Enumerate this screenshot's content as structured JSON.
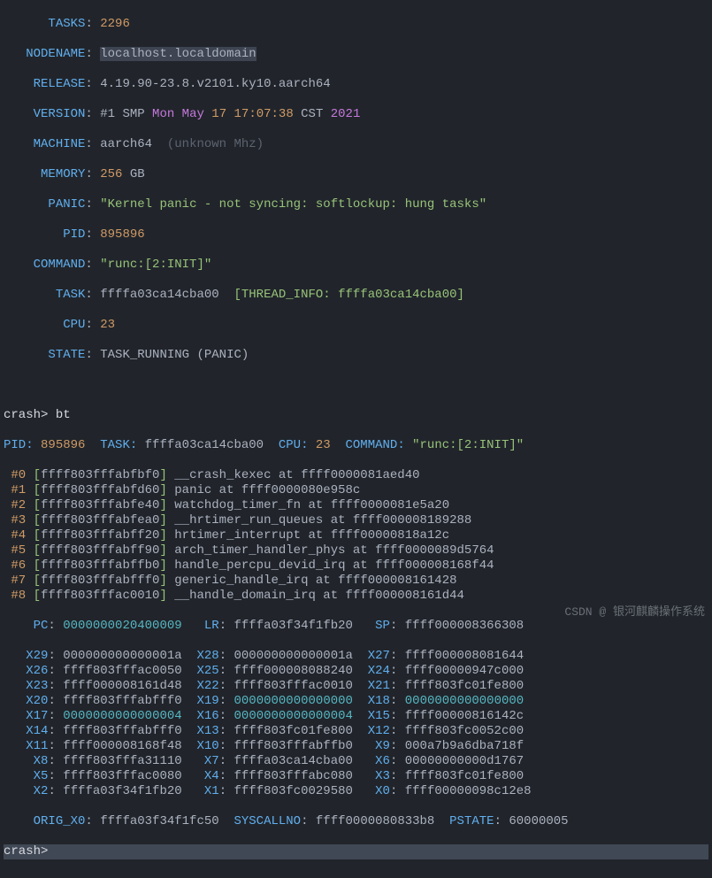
{
  "header": {
    "tasks_label": "TASKS",
    "tasks_value": "2296",
    "nodename_label": "NODENAME",
    "nodename_value": "localhost.localdomain",
    "release_label": "RELEASE",
    "release_value": "4.19.90-23.8.v2101.ky10.aarch64",
    "version_label": "VERSION",
    "version_prefix": "#1 SMP ",
    "version_weekday": "Mon",
    "version_month": "May",
    "version_day": "17",
    "version_time": "17:07:38",
    "version_tz": "CST ",
    "version_year": "2021",
    "machine_label": "MACHINE",
    "machine_value": "aarch64  ",
    "machine_paren": "(",
    "machine_unknown": "unknown",
    "machine_mhz": " Mhz)",
    "memory_label": "MEMORY",
    "memory_value": "256",
    "memory_unit": " GB",
    "panic_label": "PANIC",
    "panic_value": "\"Kernel panic - not syncing: softlockup: hung tasks\"",
    "pid_label": "PID",
    "pid_value": "895896",
    "command_label": "COMMAND",
    "command_value": "\"runc:[2:INIT]\"",
    "task_label": "TASK",
    "task_value": "ffffa03ca14cba00  ",
    "task_thread": "[THREAD_INFO: ffffa03ca14cba00]",
    "cpu_label": "CPU",
    "cpu_value": "23",
    "state_label": "STATE",
    "state_value": "TASK_RUNNING (PANIC)"
  },
  "cmd1": {
    "prompt": "crash> ",
    "text": "bt"
  },
  "bthdr": {
    "pid_l": "PID: ",
    "pid_v": "895896",
    "task_l": "  TASK: ",
    "task_v": "ffffa03ca14cba00",
    "cpu_l": "  CPU: ",
    "cpu_v": "23",
    "cmd_l": "  COMMAND: ",
    "cmd_v": "\"runc:[2:INIT]\""
  },
  "frames": [
    {
      "idx": "#0",
      "addr": "ffff803fffabfbf0",
      "fn": "__crash_kexec",
      "at": "ffff0000081aed40"
    },
    {
      "idx": "#1",
      "addr": "ffff803fffabfd60",
      "fn": "panic",
      "at": "ffff0000080e958c"
    },
    {
      "idx": "#2",
      "addr": "ffff803fffabfe40",
      "fn": "watchdog_timer_fn",
      "at": "ffff0000081e5a20"
    },
    {
      "idx": "#3",
      "addr": "ffff803fffabfea0",
      "fn": "__hrtimer_run_queues",
      "at": "ffff000008189288"
    },
    {
      "idx": "#4",
      "addr": "ffff803fffabff20",
      "fn": "hrtimer_interrupt",
      "at": "ffff00000818a12c"
    },
    {
      "idx": "#5",
      "addr": "ffff803fffabff90",
      "fn": "arch_timer_handler_phys",
      "at": "ffff0000089d5764"
    },
    {
      "idx": "#6",
      "addr": "ffff803fffabffb0",
      "fn": "handle_percpu_devid_irq",
      "at": "ffff000008168f44"
    },
    {
      "idx": "#7",
      "addr": "ffff803fffabfff0",
      "fn": "generic_handle_irq",
      "at": "ffff000008161428"
    },
    {
      "idx": "#8",
      "addr": "ffff803fffac0010",
      "fn": "__handle_domain_irq",
      "at": "ffff000008161d44"
    }
  ],
  "regs_pc": {
    "PC": "0000000020400009",
    "LR": "ffffa03f34f1fb20",
    "SP": "ffff000008366308"
  },
  "regs": [
    {
      "a": "X29",
      "av": "000000000000001a",
      "b": "X28",
      "bv": "000000000000001a",
      "c": "X27",
      "cv": "ffff000008081644"
    },
    {
      "a": "X26",
      "av": "ffff803fffac0050",
      "b": "X25",
      "bv": "ffff000008088240",
      "c": "X24",
      "cv": "ffff00000947c000"
    },
    {
      "a": "X23",
      "av": "ffff000008161d48",
      "b": "X22",
      "bv": "ffff803fffac0010",
      "c": "X21",
      "cv": "ffff803fc01fe800"
    },
    {
      "a": "X20",
      "av": "ffff803fffabfff0",
      "b": "X19",
      "bv": "0000000000000000",
      "c": "X18",
      "cv": "0000000000000000"
    },
    {
      "a": "X17",
      "av": "0000000000000004",
      "b": "X16",
      "bv": "0000000000000004",
      "c": "X15",
      "cv": "ffff00000816142c"
    },
    {
      "a": "X14",
      "av": "ffff803fffabfff0",
      "b": "X13",
      "bv": "ffff803fc01fe800",
      "c": "X12",
      "cv": "ffff803fc0052c00"
    },
    {
      "a": "X11",
      "av": "ffff000008168f48",
      "b": "X10",
      "bv": "ffff803fffabffb0",
      "c": " X9",
      "cv": "000a7b9a6dba718f"
    },
    {
      "a": " X8",
      "av": "ffff803fffa31110",
      "b": " X7",
      "bv": "ffffa03ca14cba00",
      "c": " X6",
      "cv": "00000000000d1767"
    },
    {
      "a": " X5",
      "av": "ffff803fffac0080",
      "b": " X4",
      "bv": "ffff803fffabc080",
      "c": " X3",
      "cv": "ffff803fc01fe800"
    },
    {
      "a": " X2",
      "av": "ffffa03f34f1fb20",
      "b": " X1",
      "bv": "ffff803fc0029580",
      "c": " X0",
      "cv": "ffff00000098c12e8"
    }
  ],
  "tail": {
    "orig_label": "ORIG_X0",
    "orig_val": "ffffa03f34f1fc50",
    "syscall_label": "SYSCALLNO",
    "syscall_val": "ffff0000080833b8",
    "pstate_label": "PSTATE",
    "pstate_val": "60000005"
  },
  "prompt2": "crash>",
  "watermark": "CSDN @ 银河麒麟操作系统"
}
